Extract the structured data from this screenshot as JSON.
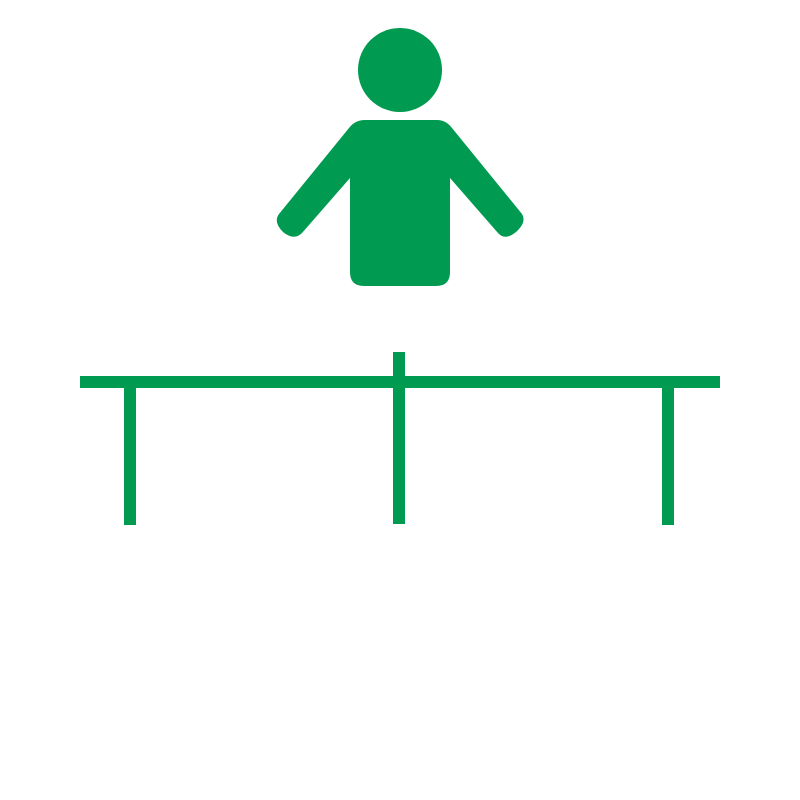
{
  "icon": {
    "name": "person-above-table-pictogram",
    "color": "#009A50",
    "background": "#FFFFFF",
    "parts": [
      "person-icon",
      "table-icon"
    ]
  }
}
